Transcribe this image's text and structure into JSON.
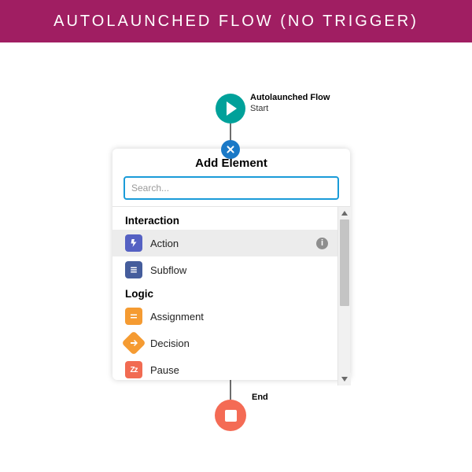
{
  "banner": {
    "title": "AUTOLAUNCHED FLOW (NO TRIGGER)"
  },
  "start": {
    "title": "Autolaunched Flow",
    "subtitle": "Start"
  },
  "end": {
    "label": "End"
  },
  "popover": {
    "title": "Add Element",
    "search_placeholder": "Search...",
    "groups": [
      {
        "label": "Interaction",
        "items": [
          {
            "label": "Action",
            "icon": "action-icon",
            "hover": true,
            "info": true
          },
          {
            "label": "Subflow",
            "icon": "subflow-icon",
            "hover": false,
            "info": false
          }
        ]
      },
      {
        "label": "Logic",
        "items": [
          {
            "label": "Assignment",
            "icon": "assignment-icon",
            "hover": false,
            "info": false
          },
          {
            "label": "Decision",
            "icon": "decision-icon",
            "hover": false,
            "info": false
          },
          {
            "label": "Pause",
            "icon": "pause-icon",
            "hover": false,
            "info": false
          }
        ]
      }
    ]
  }
}
